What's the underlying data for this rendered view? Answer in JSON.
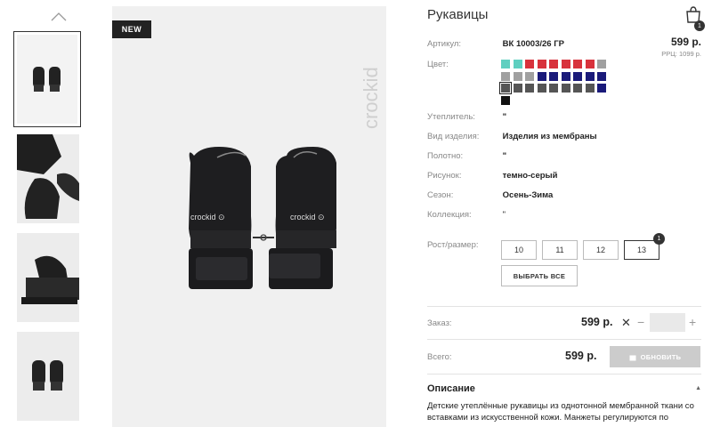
{
  "product": {
    "title": "Рукавицы",
    "badge": "NEW",
    "brand": "crockid",
    "cart_count": "1"
  },
  "thumbnails": [
    {
      "label": "thumbnail-1"
    },
    {
      "label": "thumbnail-2"
    },
    {
      "label": "thumbnail-3"
    },
    {
      "label": "thumbnail-4"
    }
  ],
  "details": {
    "article_label": "Артикул:",
    "article_value": "ВК 10003/26 ГР",
    "price": "599 р.",
    "rrp": "РРЦ: 1099 р.",
    "color_label": "Цвет:",
    "filling_label": "Утеплитель:",
    "filling_value": "\"",
    "type_label": "Вид изделия:",
    "type_value": "Изделия из мембраны",
    "fabric_label": "Полотно:",
    "fabric_value": "\"",
    "pattern_label": "Рисунок:",
    "pattern_value": "темно-серый",
    "season_label": "Сезон:",
    "season_value": "Осень-Зима",
    "collection_label": "Коллекция:",
    "collection_value": "\"",
    "size_label": "Рост/размер:"
  },
  "swatch_colors": [
    "#5fcfc0",
    "#5fcfc0",
    "#d8323c",
    "#d8323c",
    "#d8323c",
    "#d8323c",
    "#d8323c",
    "#d8323c",
    "#a0a0a0",
    "#a0a0a0",
    "#a0a0a0",
    "#a0a0a0",
    "#1a1a7a",
    "#1a1a7a",
    "#1a1a7a",
    "#1a1a7a",
    "#1a1a7a",
    "#1a1a7a",
    "#555555",
    "#555555",
    "#555555",
    "#555555",
    "#555555",
    "#555555",
    "#555555",
    "#555555",
    "#1a1a7a",
    "#111111"
  ],
  "sizes": [
    {
      "label": "10",
      "selected": false
    },
    {
      "label": "11",
      "selected": false
    },
    {
      "label": "12",
      "selected": false
    },
    {
      "label": "13",
      "selected": true,
      "badge": "1"
    }
  ],
  "select_all_label": "ВЫБРАТЬ ВСЕ",
  "order": {
    "order_label": "Заказ:",
    "order_price": "599 р.",
    "remove_symbol": "✕",
    "minus": "−",
    "plus": "+",
    "total_label": "Всего:",
    "total_price": "599 р.",
    "update_label": "ОБНОВИТЬ"
  },
  "description": {
    "title": "Описание",
    "caret": "▲",
    "text": "Детские утеплённые рукавицы из однотонной мембранной ткани со вставками из искусственной кожи. Манжеты регулируются по"
  }
}
